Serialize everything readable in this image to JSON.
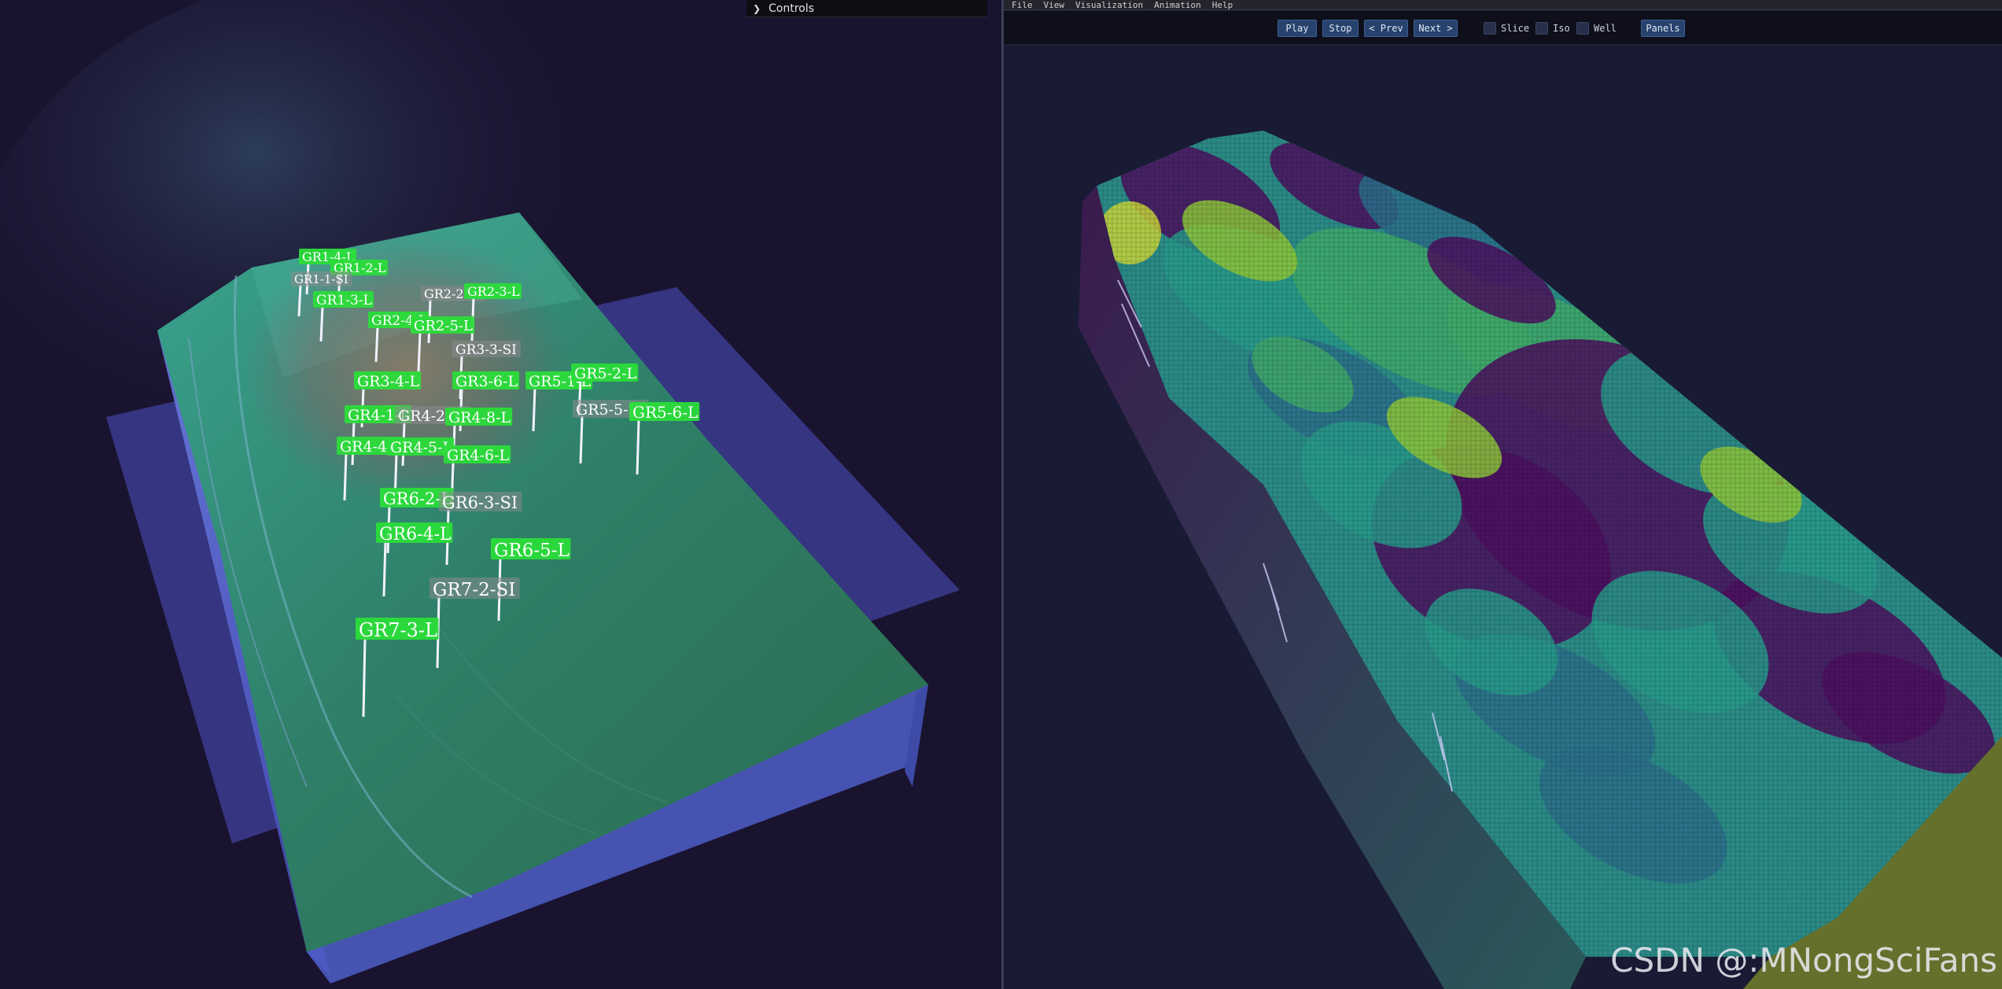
{
  "controls_panel": {
    "title": "Controls",
    "icon": "chevron-right-icon"
  },
  "menu": {
    "items": [
      "File",
      "View",
      "Visualization",
      "Animation",
      "Help"
    ]
  },
  "toolbar": {
    "play_label": "Play",
    "stop_label": "Stop",
    "prev_label": "< Prev",
    "next_label": "Next >",
    "slice_label": "Slice",
    "iso_label": "Iso",
    "well_label": "Well",
    "panels_label": "Panels",
    "slice_checked": false,
    "iso_checked": false,
    "well_checked": false
  },
  "wells": {
    "green_color": "#2bdc3a",
    "gray_color": "#8a8a8e",
    "labels": [
      {
        "id": "gr1-4",
        "text": "GR1-4-L",
        "style": "green"
      },
      {
        "id": "gr1-2",
        "text": "GR1-2-L",
        "style": "green"
      },
      {
        "id": "gr1-1",
        "text": "GR1-1-SI",
        "style": "gray"
      },
      {
        "id": "gr1-3",
        "text": "GR1-3-L",
        "style": "green"
      },
      {
        "id": "gr2-2",
        "text": "GR2-2-SI",
        "style": "gray"
      },
      {
        "id": "gr2-3",
        "text": "GR2-3-L",
        "style": "green"
      },
      {
        "id": "gr2-4",
        "text": "GR2-4-L",
        "style": "green"
      },
      {
        "id": "gr2-5",
        "text": "GR2-5-L",
        "style": "green"
      },
      {
        "id": "gr3-3",
        "text": "GR3-3-SI",
        "style": "gray"
      },
      {
        "id": "gr3-4",
        "text": "GR3-4-L",
        "style": "green"
      },
      {
        "id": "gr3-6",
        "text": "GR3-6-L",
        "style": "green"
      },
      {
        "id": "gr5-1",
        "text": "GR5-1-L",
        "style": "green"
      },
      {
        "id": "gr5-2",
        "text": "GR5-2-L",
        "style": "green"
      },
      {
        "id": "gr4-1",
        "text": "GR4-1-L",
        "style": "green"
      },
      {
        "id": "gr4-2",
        "text": "GR4-2-SI",
        "style": "gray"
      },
      {
        "id": "gr4-8",
        "text": "GR4-8-L",
        "style": "green"
      },
      {
        "id": "gr5-5",
        "text": "GR5-5-SI",
        "style": "gray"
      },
      {
        "id": "gr5-6",
        "text": "GR5-6-L",
        "style": "green"
      },
      {
        "id": "gr4-4",
        "text": "GR4-4-L",
        "style": "green"
      },
      {
        "id": "gr4-5",
        "text": "GR4-5-L",
        "style": "green"
      },
      {
        "id": "gr4-6",
        "text": "GR4-6-L",
        "style": "green"
      },
      {
        "id": "gr6-2",
        "text": "GR6-2-L",
        "style": "green"
      },
      {
        "id": "gr6-3",
        "text": "GR6-3-SI",
        "style": "gray"
      },
      {
        "id": "gr6-4",
        "text": "GR6-4-L",
        "style": "green"
      },
      {
        "id": "gr6-5",
        "text": "GR6-5-L",
        "style": "green"
      },
      {
        "id": "gr7-2",
        "text": "GR7-2-SI",
        "style": "gray"
      },
      {
        "id": "gr7-3",
        "text": "GR7-3-L",
        "style": "green"
      }
    ]
  },
  "voxel_colors": [
    "#4b0f5e",
    "#2a6f8a",
    "#27998a",
    "#3fa86a",
    "#8cc43a",
    "#c8d43a"
  ],
  "watermark": "CSDN @:MNongSciFans"
}
